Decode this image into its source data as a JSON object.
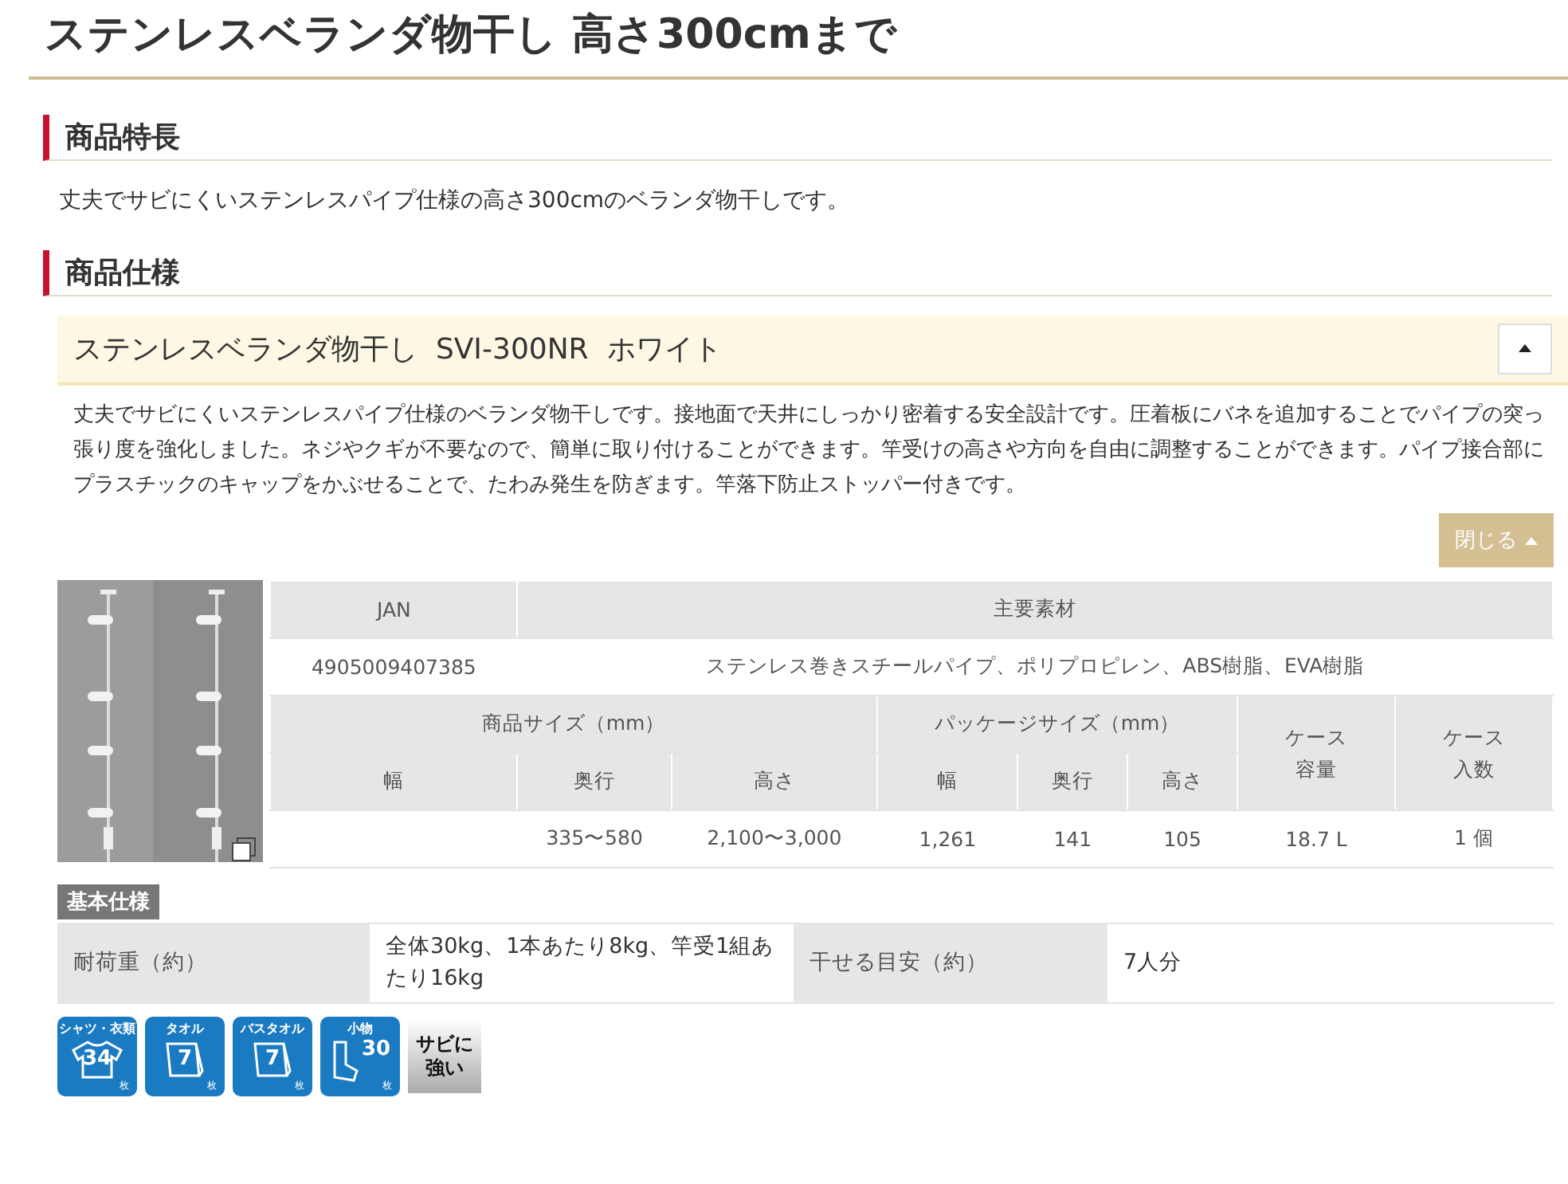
{
  "page_title": "ステンレスベランダ物干し 高さ300cmまで",
  "features": {
    "heading": "商品特長",
    "text": "丈夫でサビにくいステンレスパイプ仕様の高さ300cmのベランダ物干しです。"
  },
  "specs": {
    "heading": "商品仕様",
    "product": {
      "name": "ステンレスベランダ物干し  SVI-300NR  ホワイト",
      "expanded": true,
      "description": "丈夫でサビにくいステンレスパイプ仕様のベランダ物干しです。接地面で天井にしっかり密着する安全設計です。圧着板にバネを追加することでパイプの突っ張り度を強化しました。ネジやクギが不要なので、簡単に取り付けることができます。竿受けの高さや方向を自由に調整することができます。パイプ接合部にプラスチックのキャップをかぶせることで、たわみ発生を防ぎます。竿落下防止ストッパー付きです。",
      "close_button": "閉じる"
    },
    "table": {
      "jan_header": "JAN",
      "material_header": "主要素材",
      "jan": "4905009407385",
      "material": "ステンレス巻きスチールパイプ、ポリプロピレン、ABS樹脂、EVA樹脂",
      "groups": [
        {
          "label": "商品サイズ（mm）",
          "columns": [
            "幅",
            "奥行",
            "高さ"
          ]
        },
        {
          "label": "パッケージサイズ（mm）",
          "columns": [
            "幅",
            "奥行",
            "高さ"
          ]
        }
      ],
      "case_headers": [
        "ケース容量",
        "ケース入数"
      ],
      "values": [
        "335〜580",
        "2,100〜3,000",
        "1,261",
        "141",
        "105",
        "18.7 L",
        "1 個"
      ]
    },
    "basic_spec": {
      "label": "基本仕様",
      "rows": [
        {
          "label": "耐荷重（約）",
          "value": "全体30kg、1本あたり8kg、竿受1組あたり16kg"
        },
        {
          "label": "干せる目安（約）",
          "value": "7人分"
        }
      ]
    },
    "badges": [
      {
        "kind": "shirt",
        "title": "シャツ・衣類",
        "count": "34",
        "unit": "枚"
      },
      {
        "kind": "towel",
        "title": "タオル",
        "count": "7",
        "unit": "枚"
      },
      {
        "kind": "towel",
        "title": "バスタオル",
        "count": "7",
        "unit": "枚"
      },
      {
        "kind": "sock",
        "title": "小物",
        "count": "30",
        "unit": "枚"
      },
      {
        "kind": "text",
        "text": "サビに強い"
      }
    ]
  }
}
